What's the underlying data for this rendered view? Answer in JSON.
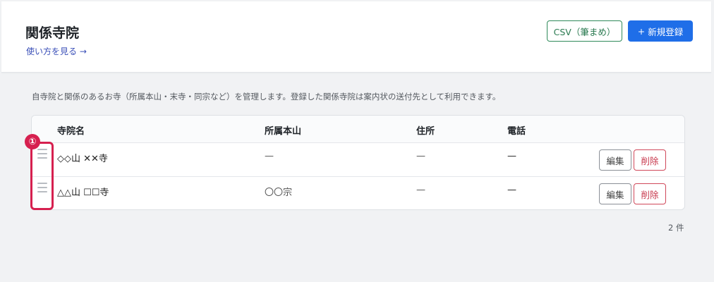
{
  "header": {
    "title": "関係寺院",
    "howto_link": "使い方を見る →",
    "csv_button": "CSV（筆まめ）",
    "new_button_icon": "+",
    "new_button_label": "新規登録"
  },
  "description": "自寺院と関係のあるお寺（所属本山・末寺・同宗など）を管理します。登録した関係寺院は案内状の送付先として利用できます。",
  "table": {
    "columns": [
      "寺院名",
      "所属本山",
      "住所",
      "電話"
    ],
    "rows": [
      {
        "name": "◇◇山 ✕✕寺",
        "honzan": "—",
        "address": "—",
        "phone": "—"
      },
      {
        "name": "△△山 ☐☐寺",
        "honzan": "〇〇宗",
        "address": "—",
        "phone": "—"
      }
    ],
    "edit_label": "編集",
    "delete_label": "削除"
  },
  "count": "2 件",
  "annotation": {
    "marker": "①",
    "color": "#d6204f"
  },
  "colors": {
    "primary": "#1f6ee8",
    "csv_green": "#2a7a50",
    "danger": "#c8394d"
  }
}
